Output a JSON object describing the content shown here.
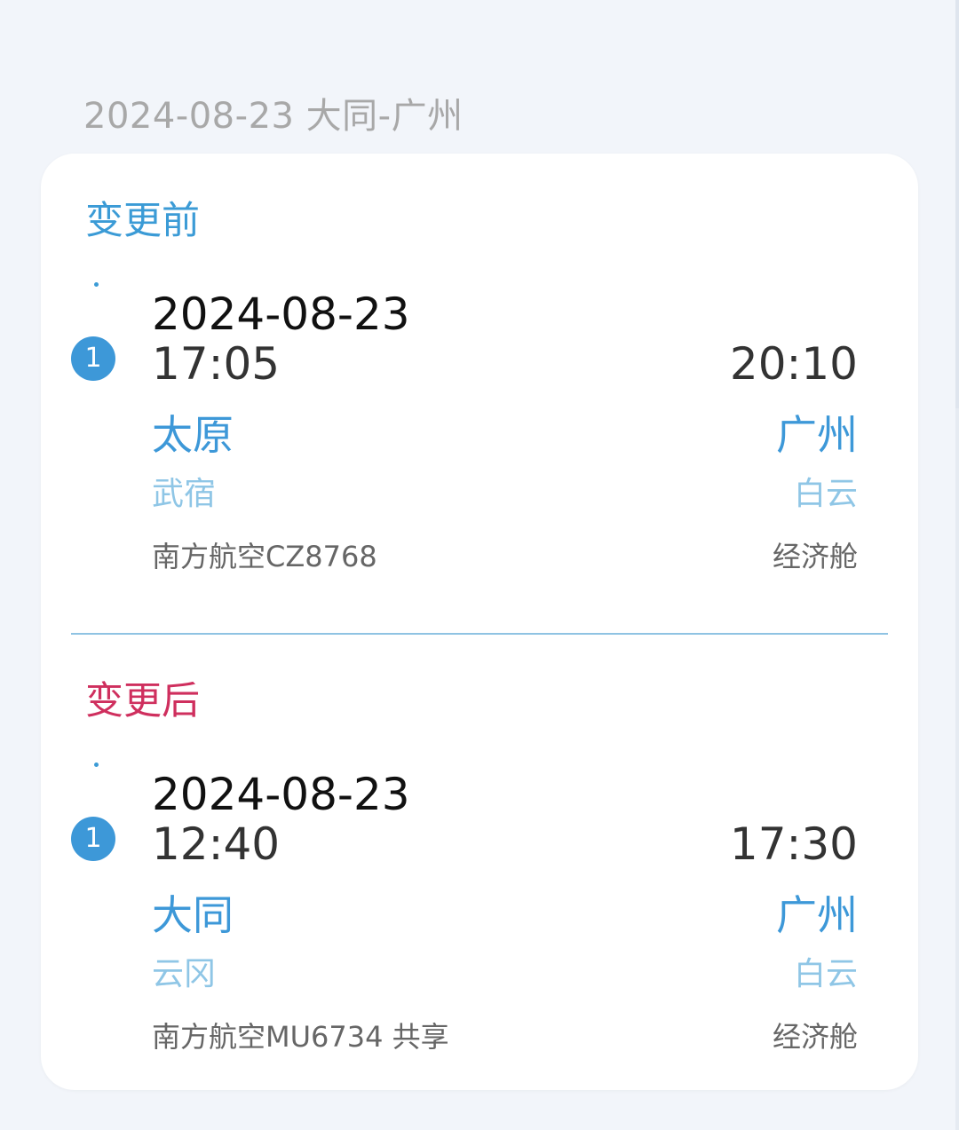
{
  "header": {
    "route_summary": "2024-08-23 大同-广州"
  },
  "before": {
    "title": "变更前",
    "segment_number": "1",
    "date": "2024-08-23",
    "departure_time": "17:05",
    "arrival_time": "20:10",
    "departure_city": "太原",
    "arrival_city": "广州",
    "departure_airport": "武宿",
    "arrival_airport": "白云",
    "flight": "南方航空CZ8768",
    "cabin": "经济舱"
  },
  "after": {
    "title": "变更后",
    "segment_number": "1",
    "date": "2024-08-23",
    "departure_time": "12:40",
    "arrival_time": "17:30",
    "departure_city": "大同",
    "arrival_city": "广州",
    "departure_airport": "云冈",
    "arrival_airport": "白云",
    "flight": "南方航空MU6734 共享",
    "cabin": "经济舱"
  },
  "colors": {
    "accent_blue": "#3d98d8",
    "accent_red": "#cf2f5e",
    "light_blue": "#8fc6e6",
    "background": "#f2f5fa"
  }
}
